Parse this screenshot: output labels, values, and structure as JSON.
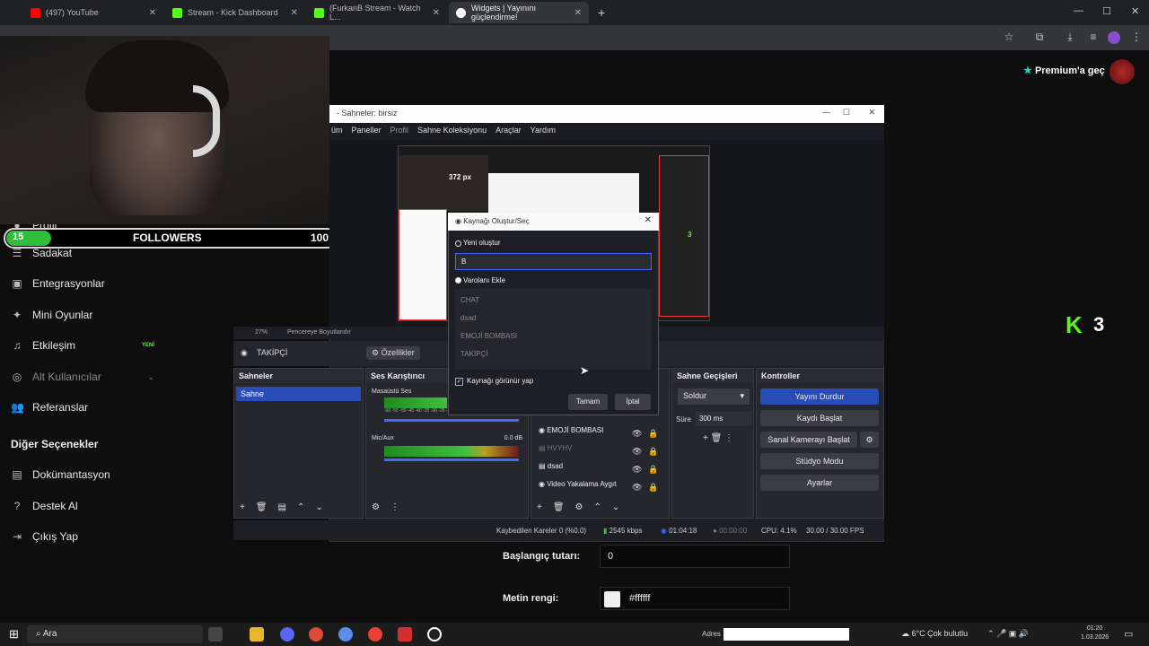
{
  "browser": {
    "tabs": [
      {
        "label": "(497) YouTube",
        "color": "#ff0000"
      },
      {
        "label": "Stream - Kick Dashboard",
        "color": "#53fc18"
      },
      {
        "label": "(FurkanB Stream - Watch L...",
        "color": "#53fc18"
      },
      {
        "label": "Widgets | Yayınını güçlendirme!",
        "color": "#ffffff"
      }
    ],
    "new_tab": "+"
  },
  "header": {
    "premium_label": "Premium'a geç",
    "premium_star": "★"
  },
  "overlay": {
    "followers_count": "15",
    "followers_label": "FOLLOWERS",
    "followers_goal": "100",
    "progress_fraction": 0.15
  },
  "sidebar": {
    "items": [
      {
        "label": "Profil",
        "icon": "user-icon"
      },
      {
        "label": "Sadakat",
        "icon": "loyalty-icon"
      },
      {
        "label": "Entegrasyonlar",
        "icon": "integrations-icon"
      },
      {
        "label": "Mini Oyunlar",
        "icon": "gamepad-icon"
      },
      {
        "label": "Etkileşim",
        "icon": "music-icon",
        "badge": "YENİ"
      },
      {
        "label": "Alt Kullanıcılar",
        "icon": "subusers-icon"
      },
      {
        "label": "Referanslar",
        "icon": "referrals-icon"
      }
    ],
    "section_title": "Diğer Seçenekler",
    "other_items": [
      {
        "label": "Dokümantasyon",
        "icon": "doc-icon"
      },
      {
        "label": "Destek Al",
        "icon": "help-icon"
      },
      {
        "label": "Çıkış Yap",
        "icon": "logout-icon"
      }
    ]
  },
  "obs": {
    "title": "- Sahneler: birsiz",
    "menu": [
      "üm",
      "Paneller",
      "Profil",
      "Sahne Koleksiyonu",
      "Araçlar",
      "Yardım"
    ],
    "preview_px": "372 px",
    "kick_badge": "3",
    "zoom": "27%",
    "zoom_mode": "Pencereye Boyutlandır",
    "selected_source": "TAKİPÇİ",
    "properties_btn": "Özellikler",
    "docks": {
      "scenes": {
        "title": "Sahneler",
        "items": [
          "Sahne"
        ]
      },
      "mixer": {
        "title": "Ses Karıştırıcı",
        "channels": [
          {
            "name": "Masaüstü Ses",
            "level": ""
          },
          {
            "name": "Mic/Aux",
            "level": "0.0 dB"
          }
        ],
        "scale": "-60 -55 -50 -45 -40 -35 -30 -25 -20 -15 -10 -5 0"
      },
      "sources": {
        "items": [
          "EMOJİ BOMBASI",
          "HVYHV",
          "dsad",
          "Video Yakalama Aygıt"
        ]
      },
      "transitions": {
        "title": "Sahne Geçişleri",
        "type": "Soldur",
        "duration_label": "Süre",
        "duration_value": "300 ms"
      },
      "controls": {
        "title": "Kontroller",
        "buttons": [
          "Yayını Durdur",
          "Kaydı Başlat",
          "Sanal Kamerayı Başlat",
          "Stüdyo Modu",
          "Ayarlar"
        ]
      }
    },
    "status": {
      "dropped": "Kaybedilen Kareler 0 (%0.0)",
      "bitrate": "2545 kbps",
      "live_time": "01:04:18",
      "rec_time": "00:00:00",
      "cpu": "CPU: 4.1%",
      "fps": "30.00 / 30.00 FPS"
    }
  },
  "dialog": {
    "title": "Kaynağı Oluştur/Seç",
    "new_label": "Yeni oluştur",
    "new_value": "B",
    "existing_label": "Varolanı Ekle",
    "existing_items": [
      "CHAT",
      "dsad",
      "EMOJİ BOMBASI",
      "TAKİPÇİ"
    ],
    "visible_label": "Kaynağı görünür yap",
    "ok": "Tamam",
    "cancel": "İptal"
  },
  "form": {
    "start_label": "Başlangıç tutarı:",
    "start_value": "0",
    "color_label": "Metin rengi:",
    "color_value": "#ffffff"
  },
  "kick_logo": {
    "letter": "K",
    "number": "3"
  },
  "taskbar": {
    "search": "Ara",
    "address_label": "Adres",
    "weather": "6°C  Çok bulutlu",
    "time": "01:20",
    "date": "1.03.2026"
  }
}
